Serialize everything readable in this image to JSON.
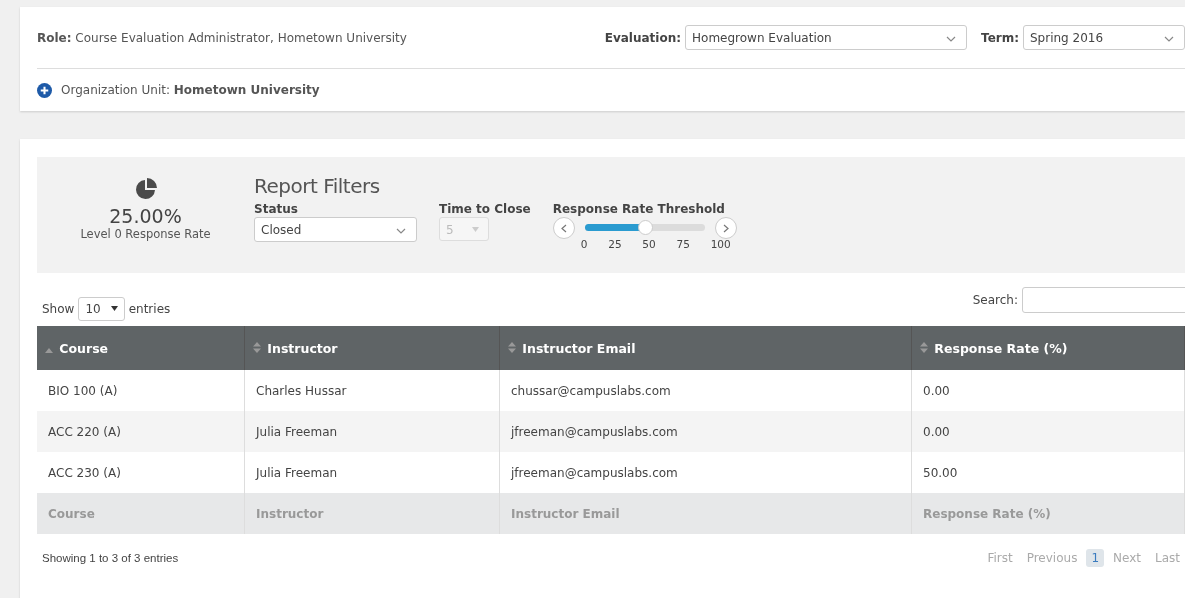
{
  "header": {
    "role_label": "Role:",
    "role": "Course Evaluation Administrator, Hometown University",
    "evaluation_label": "Evaluation:",
    "evaluation": "Homegrown Evaluation",
    "term_label": "Term:",
    "term": "Spring 2016",
    "org_label": "Organization Unit:",
    "org": "Hometown University"
  },
  "summary": {
    "value": "25.00%",
    "label": "Level 0 Response Rate"
  },
  "filters": {
    "title": "Report Filters",
    "status": {
      "label": "Status",
      "value": "Closed",
      "disabled": false
    },
    "time_to_close": {
      "label": "Time to Close",
      "value": "5",
      "disabled": true
    },
    "threshold": {
      "label": "Response Rate Threshold",
      "level": 0.5,
      "ticks": [
        "0",
        "25",
        "50",
        "75",
        "100"
      ]
    }
  },
  "length": {
    "show": "Show",
    "value": "10",
    "entries": "entries"
  },
  "search": {
    "label": "Search:"
  },
  "table": {
    "columns": [
      {
        "label": "Course",
        "sorted": true
      },
      {
        "label": "Instructor",
        "sorted": false
      },
      {
        "label": "Instructor Email",
        "sorted": false
      },
      {
        "label": "Response Rate (%)",
        "sorted": false
      }
    ],
    "rows": [
      [
        "BIO 100 (A)",
        "Charles Hussar",
        "chussar@campuslabs.com",
        "0.00"
      ],
      [
        "ACC 220 (A)",
        "Julia Freeman",
        "jfreeman@campuslabs.com",
        "0.00"
      ],
      [
        "ACC 230 (A)",
        "Julia Freeman",
        "jfreeman@campuslabs.com",
        "50.00"
      ]
    ],
    "footer": [
      "Course",
      "Instructor",
      "Instructor Email",
      "Response Rate (%)"
    ]
  },
  "info": "Showing 1 to 3 of 3 entries",
  "pagination": [
    {
      "label": "First",
      "selected": false
    },
    {
      "label": "Previous",
      "selected": false
    },
    {
      "label": "1",
      "selected": true
    },
    {
      "label": "Next",
      "selected": false
    },
    {
      "label": "Last",
      "selected": false
    }
  ]
}
